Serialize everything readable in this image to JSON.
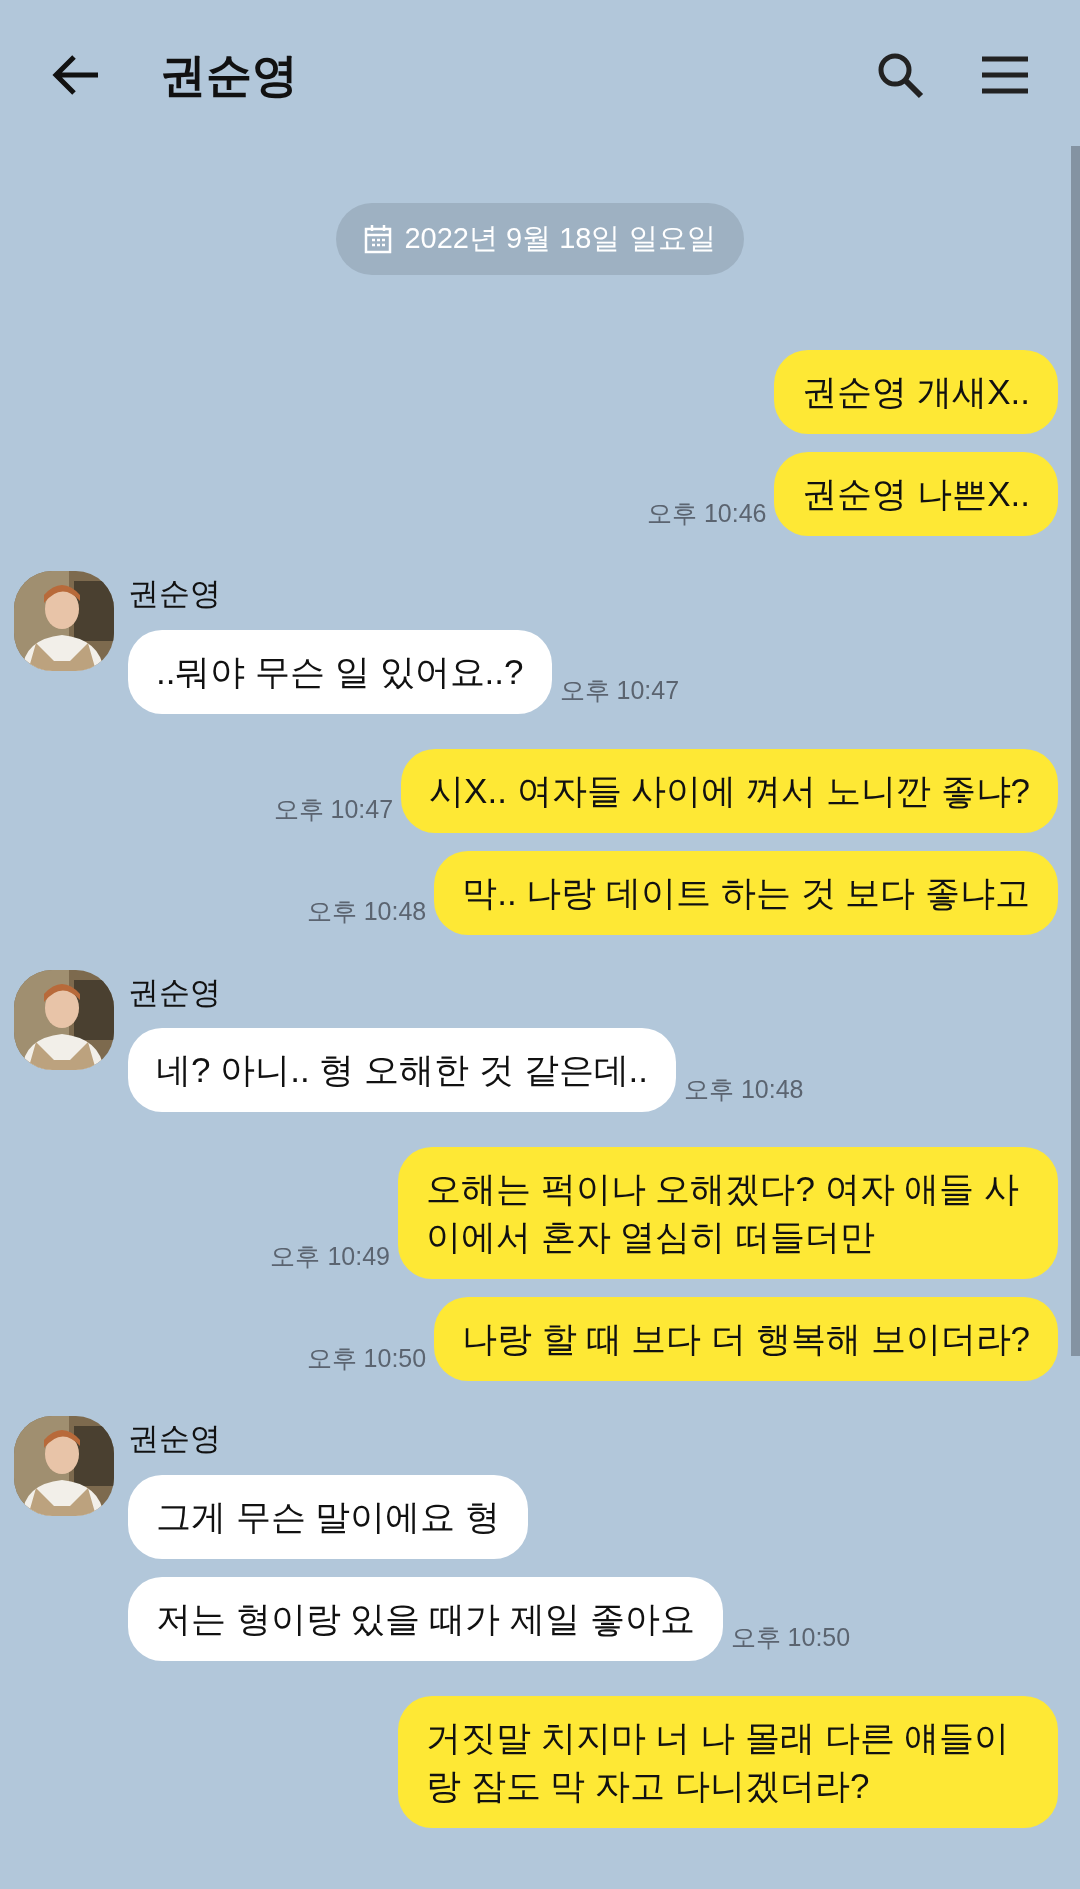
{
  "header": {
    "title": "권순영"
  },
  "date_divider": "2022년 9월 18일 일요일",
  "messages": [
    {
      "kind": "sent",
      "bubbles": [
        {
          "text": "권순영 개새X.."
        },
        {
          "text": "권순영 나쁜X..",
          "time": "오후 10:46"
        }
      ]
    },
    {
      "kind": "received",
      "name": "권순영",
      "bubbles": [
        {
          "text": "..뭐야 무슨 일 있어요..?",
          "time": "오후 10:47"
        }
      ]
    },
    {
      "kind": "sent",
      "bubbles": [
        {
          "text": "시X.. 여자들 사이에 껴서 노니깐 좋냐?",
          "time": "오후 10:47"
        },
        {
          "text": "막.. 나랑 데이트 하는 것 보다 좋냐고",
          "time": "오후 10:48"
        }
      ]
    },
    {
      "kind": "received",
      "name": "권순영",
      "bubbles": [
        {
          "text": "네? 아니.. 형 오해한 것 같은데..",
          "time": "오후 10:48"
        }
      ]
    },
    {
      "kind": "sent",
      "bubbles": [
        {
          "text": "오해는 퍽이나 오해겠다? 여자 애들 사이에서 혼자 열심히 떠들더만",
          "time": "오후 10:49"
        },
        {
          "text": "나랑 할 때 보다 더 행복해 보이더라?",
          "time": "오후 10:50"
        }
      ]
    },
    {
      "kind": "received",
      "name": "권순영",
      "bubbles": [
        {
          "text": "그게 무슨 말이에요 형"
        },
        {
          "text": "저는 형이랑 있을 때가 제일 좋아요",
          "time": "오후 10:50"
        }
      ]
    },
    {
      "kind": "sent",
      "bubbles": [
        {
          "text": "거짓말 치지마 너 나 몰래 다른 얘들이랑 잠도 막 자고 다니겠더라?"
        }
      ]
    }
  ]
}
